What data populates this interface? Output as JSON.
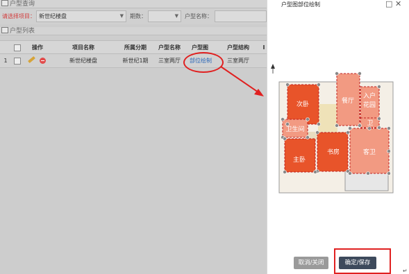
{
  "app": {
    "section_query": "户型查询",
    "section_list": "户型列表",
    "filter": {
      "project_label": "请选择项目：",
      "project_value": "新世纪楼盘",
      "period_label": "期数：",
      "period_value": "",
      "name_label": "户型名称：",
      "name_value": ""
    },
    "table": {
      "headers": [
        "操作",
        "项目名称",
        "所属分期",
        "户型名称",
        "户型图",
        "户型结构",
        "I"
      ],
      "row": {
        "index": "1",
        "project": "新世纪楼盘",
        "period": "新世纪1期",
        "name": "三室两厅",
        "plan_link": "部位绘制",
        "structure": "三室两厅"
      }
    }
  },
  "dialog": {
    "title": "户型图部位绘制",
    "rooms": {
      "bedroom2": "次卧",
      "dining": "餐厅",
      "entrance": "入户",
      "garden": "花园",
      "bath": "卫生间",
      "bath_side": "卫",
      "study": "书房",
      "master": "主卧",
      "guest": "客卫"
    },
    "cancel_label": "取消/关闭",
    "ok_label": "确定/保存",
    "return_glyph": "↵"
  },
  "colors": {
    "accent_red": "#e02020",
    "room_dark": "#e8542a",
    "room_light": "#f29a82",
    "link_blue": "#2a67b8"
  }
}
